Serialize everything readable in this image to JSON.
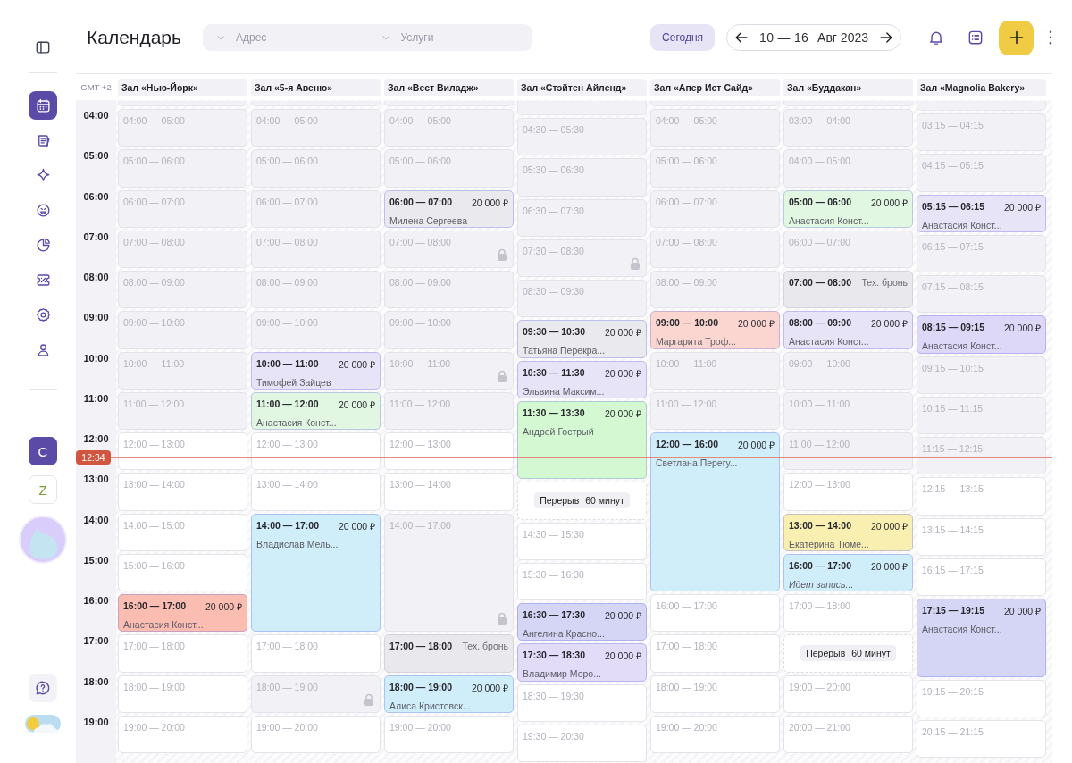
{
  "sidebar": {
    "nav": [
      {
        "selected": true
      },
      {
        "selected": false
      },
      {
        "selected": false
      },
      {
        "selected": false
      },
      {
        "selected": false
      },
      {
        "selected": false
      },
      {
        "selected": false
      },
      {
        "selected": false
      }
    ],
    "workspaces": [
      {
        "letter": "C",
        "selected": true
      },
      {
        "letter": "Z",
        "selected": false
      }
    ]
  },
  "header": {
    "title": "Календарь",
    "filters": [
      {
        "placeholder": "Адрес"
      },
      {
        "placeholder": "Услуги"
      }
    ],
    "today_button": "Сегодня",
    "date_range": "10 — 16",
    "month": "Авг 2023"
  },
  "timezone": "GMT +2",
  "time_labels": [
    "04:00",
    "05:00",
    "06:00",
    "07:00",
    "08:00",
    "09:00",
    "10:00",
    "11:00",
    "12:00",
    "13:00",
    "14:00",
    "15:00",
    "16:00",
    "17:00",
    "18:00",
    "19:00"
  ],
  "now": "12:34",
  "columns": [
    {
      "title": "Зал «Нью-Йорк»",
      "slots": [
        {
          "kind": "free",
          "time": "04:00 — 05:00",
          "past": true
        },
        {
          "kind": "free",
          "time": "05:00 — 06:00",
          "past": true
        },
        {
          "kind": "free",
          "time": "06:00 — 07:00",
          "past": true
        },
        {
          "kind": "free",
          "time": "07:00 — 08:00",
          "past": true
        },
        {
          "kind": "free",
          "time": "08:00 — 09:00",
          "past": true
        },
        {
          "kind": "free",
          "time": "09:00 — 10:00",
          "past": true
        },
        {
          "kind": "free",
          "time": "10:00 — 11:00",
          "past": true
        },
        {
          "kind": "free",
          "time": "11:00 — 12:00",
          "past": true
        },
        {
          "kind": "free",
          "time": "12:00 — 13:00",
          "past": false
        },
        {
          "kind": "free",
          "time": "13:00 — 14:00",
          "past": false
        },
        {
          "kind": "free",
          "time": "14:00 — 15:00",
          "past": false
        },
        {
          "kind": "free",
          "time": "15:00 — 16:00",
          "past": false
        },
        {
          "kind": "booking",
          "time": "16:00 — 17:00",
          "price": "20 000 ₽",
          "client": "Анастасия Конст...",
          "color": "#fbbdb1"
        },
        {
          "kind": "free",
          "time": "17:00 — 18:00",
          "past": false
        },
        {
          "kind": "free",
          "time": "18:00 — 19:00",
          "past": false
        },
        {
          "kind": "free",
          "time": "19:00 — 20:00",
          "past": false
        }
      ]
    },
    {
      "title": "Зал «5-я Авеню»",
      "slots": [
        {
          "kind": "free",
          "time": "04:00 — 05:00",
          "past": true
        },
        {
          "kind": "free",
          "time": "05:00 — 06:00",
          "past": true
        },
        {
          "kind": "free",
          "time": "06:00 — 07:00",
          "past": true
        },
        {
          "kind": "free",
          "time": "07:00 — 08:00",
          "past": true
        },
        {
          "kind": "free",
          "time": "08:00 — 09:00",
          "past": true
        },
        {
          "kind": "free",
          "time": "09:00 — 10:00",
          "past": true
        },
        {
          "kind": "booking",
          "time": "10:00 — 11:00",
          "price": "20 000 ₽",
          "client": "Тимофей Зайцев",
          "color": "#e7e4f8"
        },
        {
          "kind": "booking",
          "time": "11:00 — 12:00",
          "price": "20 000 ₽",
          "client": "Анастасия Конст...",
          "color": "#e1f7e2"
        },
        {
          "kind": "free",
          "time": "12:00 — 13:00",
          "past": false
        },
        {
          "kind": "free",
          "time": "13:00 — 14:00",
          "past": false
        },
        {
          "kind": "booking",
          "time": "14:00 — 17:00",
          "price": "20 000 ₽",
          "client": "Владислав Мель...",
          "color": "#d0eefa"
        },
        {
          "kind": "free",
          "time": "17:00 — 18:00",
          "past": false
        },
        {
          "kind": "locked",
          "time": "18:00 — 19:00"
        },
        {
          "kind": "free",
          "time": "19:00 — 20:00",
          "past": false
        }
      ]
    },
    {
      "title": "Зал «Вест Виладж»",
      "slots": [
        {
          "kind": "free",
          "time": "04:00 — 05:00",
          "past": true
        },
        {
          "kind": "free",
          "time": "05:00 — 06:00",
          "past": true
        },
        {
          "kind": "booking",
          "time": "06:00 — 07:00",
          "price": "20 000 ₽",
          "client": "Милена Сергеева",
          "color": "#e9e9ee"
        },
        {
          "kind": "locked",
          "time": "07:00 — 08:00"
        },
        {
          "kind": "free",
          "time": "08:00 — 09:00",
          "past": true
        },
        {
          "kind": "free",
          "time": "09:00 — 10:00",
          "past": true
        },
        {
          "kind": "locked",
          "time": "10:00 — 11:00"
        },
        {
          "kind": "free",
          "time": "11:00 — 12:00",
          "past": true
        },
        {
          "kind": "free",
          "time": "12:00 — 13:00",
          "past": false
        },
        {
          "kind": "free",
          "time": "13:00 — 14:00",
          "past": false
        },
        {
          "kind": "locked",
          "time": "14:00 — 17:00"
        },
        {
          "kind": "tech",
          "time": "17:00 — 18:00",
          "note": "Тех. бронь"
        },
        {
          "kind": "booking",
          "time": "18:00 — 19:00",
          "price": "20 000 ₽",
          "client": "Алиса Кристовск...",
          "color": "#d0eefa"
        },
        {
          "kind": "free",
          "time": "19:00 — 20:00",
          "past": false
        }
      ]
    },
    {
      "title": "Зал «Стэйтен Айленд»",
      "slots": [
        {
          "kind": "free",
          "time": "04:30 — 05:30",
          "past": true
        },
        {
          "kind": "free",
          "time": "05:30 — 06:30",
          "past": true
        },
        {
          "kind": "free",
          "time": "06:30 — 07:30",
          "past": true
        },
        {
          "kind": "locked",
          "time": "07:30 — 08:30"
        },
        {
          "kind": "free",
          "time": "08:30 — 09:30",
          "past": true
        },
        {
          "kind": "booking",
          "time": "09:30 — 10:30",
          "price": "20 000 ₽",
          "client": "Татьяна Перекра...",
          "color": "#e9e9ee"
        },
        {
          "kind": "booking",
          "time": "10:30 — 11:30",
          "price": "20 000 ₽",
          "client": "Эльвина Максим...",
          "color": "#e7e4f8"
        },
        {
          "kind": "booking",
          "time": "11:30 — 13:30",
          "price": "20 000 ₽",
          "client": "Андрей Гострый",
          "color": "#d4f8d2"
        },
        {
          "kind": "break",
          "label": "Перерыв",
          "duration": "60 минут"
        },
        {
          "kind": "free",
          "time": "14:30 — 15:30",
          "past": false
        },
        {
          "kind": "free",
          "time": "15:30 — 16:30",
          "past": false
        },
        {
          "kind": "booking",
          "time": "16:30 — 17:30",
          "price": "20 000 ₽",
          "client": "Ангелина Красно...",
          "color": "#d5d5f6"
        },
        {
          "kind": "booking",
          "time": "17:30 — 18:30",
          "price": "20 000 ₽",
          "client": "Владимир Моро...",
          "color": "#e2dcf8"
        },
        {
          "kind": "free",
          "time": "18:30 — 19:30",
          "past": false
        },
        {
          "kind": "free",
          "time": "19:30 — 20:30",
          "past": false
        }
      ]
    },
    {
      "title": "Зал «Апер Ист Сайд»",
      "slots": [
        {
          "kind": "free",
          "time": "04:00 — 05:00",
          "past": true
        },
        {
          "kind": "free",
          "time": "05:00 — 06:00",
          "past": true
        },
        {
          "kind": "free",
          "time": "06:00 — 07:00",
          "past": true
        },
        {
          "kind": "free",
          "time": "07:00 — 08:00",
          "past": true
        },
        {
          "kind": "free",
          "time": "08:00 — 09:00",
          "past": true
        },
        {
          "kind": "booking",
          "time": "09:00 — 10:00",
          "price": "20 000 ₽",
          "client": "Маргарита Троф...",
          "color": "#fbd6d0"
        },
        {
          "kind": "free",
          "time": "10:00 — 11:00",
          "past": true
        },
        {
          "kind": "free",
          "time": "11:00 — 12:00",
          "past": true
        },
        {
          "kind": "booking",
          "time": "12:00 — 16:00",
          "price": "20 000 ₽",
          "client": "Светлана Перегу...",
          "color": "#d0eefa"
        },
        {
          "kind": "free",
          "time": "16:00 — 17:00",
          "past": false
        },
        {
          "kind": "free",
          "time": "17:00 — 18:00",
          "past": false
        },
        {
          "kind": "free",
          "time": "18:00 — 19:00",
          "past": false
        },
        {
          "kind": "free",
          "time": "19:00 — 20:00",
          "past": false
        }
      ]
    },
    {
      "title": "Зал «Буддакан»",
      "slots": [
        {
          "kind": "free",
          "time": "03:00 — 04:00",
          "past": true
        },
        {
          "kind": "free",
          "time": "04:00 — 05:00",
          "past": true
        },
        {
          "kind": "booking",
          "time": "05:00 — 06:00",
          "price": "20 000 ₽",
          "client": "Анастасия Конст...",
          "color": "#e1f7e2"
        },
        {
          "kind": "free",
          "time": "06:00 — 07:00",
          "past": true
        },
        {
          "kind": "tech",
          "time": "07:00 — 08:00",
          "note": "Тех. бронь"
        },
        {
          "kind": "booking",
          "time": "08:00 — 09:00",
          "price": "20 000 ₽",
          "client": "Анастасия Конст...",
          "color": "#e7e4f8"
        },
        {
          "kind": "free",
          "time": "09:00 — 10:00",
          "past": true
        },
        {
          "kind": "free",
          "time": "10:00 — 11:00",
          "past": true
        },
        {
          "kind": "free",
          "time": "11:00 — 12:00",
          "past": true
        },
        {
          "kind": "free",
          "time": "12:00 — 13:00",
          "past": false
        },
        {
          "kind": "booking",
          "time": "13:00 — 14:00",
          "price": "20 000 ₽",
          "client": "Екатерина Тюме...",
          "color": "#f8efb0"
        },
        {
          "kind": "recording",
          "time": "16:00 — 17:00",
          "price": "20 000 ₽",
          "status": "Идет запись...",
          "color": "#d0eefa"
        },
        {
          "kind": "free",
          "time": "17:00 — 18:00",
          "past": false
        },
        {
          "kind": "break",
          "label": "Перерыв",
          "duration": "60 минут"
        },
        {
          "kind": "free",
          "time": "19:00 — 20:00",
          "past": false
        },
        {
          "kind": "free",
          "time": "20:00 — 21:00",
          "past": false
        }
      ]
    },
    {
      "title": "Зал «Magnolia Bakery»",
      "slots": [
        {
          "kind": "free",
          "time": "03:15 — 04:15",
          "past": true
        },
        {
          "kind": "free",
          "time": "04:15 — 05:15",
          "past": true
        },
        {
          "kind": "booking",
          "time": "05:15 — 06:15",
          "price": "20 000 ₽",
          "client": "Анастасия Конст...",
          "color": "#e7e4f8"
        },
        {
          "kind": "free",
          "time": "06:15 — 07:15",
          "past": true
        },
        {
          "kind": "free",
          "time": "07:15 — 08:15",
          "past": true
        },
        {
          "kind": "booking",
          "time": "08:15 — 09:15",
          "price": "20 000 ₽",
          "client": "Анастасия Конст...",
          "color": "#ddd8f8"
        },
        {
          "kind": "free",
          "time": "09:15 — 10:15",
          "past": true
        },
        {
          "kind": "free",
          "time": "10:15 — 11:15",
          "past": true
        },
        {
          "kind": "free",
          "time": "11:15 — 12:15",
          "past": true
        },
        {
          "kind": "free",
          "time": "12:15 — 13:15",
          "past": false
        },
        {
          "kind": "free",
          "time": "13:15 — 14:15",
          "past": false
        },
        {
          "kind": "free",
          "time": "16:15 — 17:15",
          "past": false
        },
        {
          "kind": "booking",
          "time": "17:15 — 19:15",
          "price": "20 000 ₽",
          "client": "Анастасия Конст...",
          "color": "#d5d6f6"
        },
        {
          "kind": "free",
          "time": "19:15 — 20:15",
          "past": false
        },
        {
          "kind": "free",
          "time": "20:15 — 21:15",
          "past": false
        }
      ]
    }
  ]
}
